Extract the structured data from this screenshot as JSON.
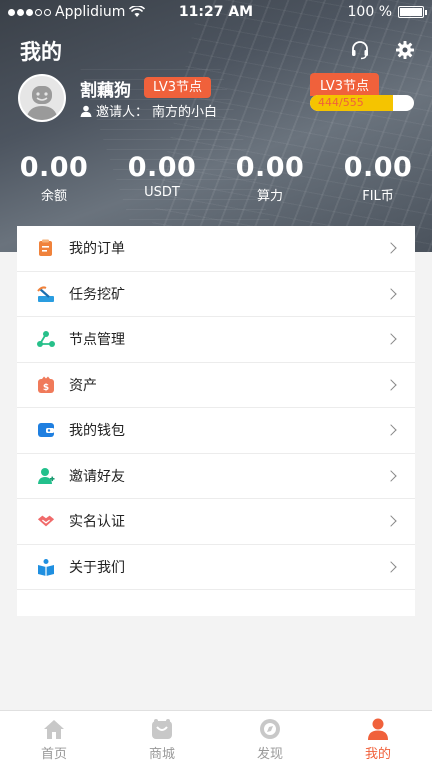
{
  "status_bar": {
    "carrier": "Applidium",
    "time": "11:27 AM",
    "battery": "100 %"
  },
  "header": {
    "title": "我的"
  },
  "profile": {
    "name": "割藕狗",
    "node_badge": "LV3节点",
    "inviter_label": "邀请人：",
    "inviter_name": "南方的小白",
    "level_label": "LV3节点",
    "level_progress_text": "444/555",
    "level_progress": 0.8
  },
  "stats": [
    {
      "value": "0.00",
      "label": "余额"
    },
    {
      "value": "0.00",
      "label": "USDT"
    },
    {
      "value": "0.00",
      "label": "算力"
    },
    {
      "value": "0.00",
      "label": "FIL币"
    }
  ],
  "menu": [
    {
      "label": "我的订单",
      "icon": "order-icon"
    },
    {
      "label": "任务挖矿",
      "icon": "mining-icon"
    },
    {
      "label": "节点管理",
      "icon": "node-icon"
    },
    {
      "label": "资产",
      "icon": "asset-icon"
    },
    {
      "label": "我的钱包",
      "icon": "wallet-icon"
    },
    {
      "label": "邀请好友",
      "icon": "invite-friend-icon"
    },
    {
      "label": "实名认证",
      "icon": "handshake-icon"
    },
    {
      "label": "关于我们",
      "icon": "about-icon"
    }
  ],
  "tabs": [
    {
      "label": "首页",
      "icon": "home-icon"
    },
    {
      "label": "商城",
      "icon": "shop-icon"
    },
    {
      "label": "发现",
      "icon": "compass-icon"
    },
    {
      "label": "我的",
      "icon": "user-icon",
      "active": true
    }
  ],
  "colors": {
    "accent": "#f0613b",
    "progress": "#f5c400"
  }
}
